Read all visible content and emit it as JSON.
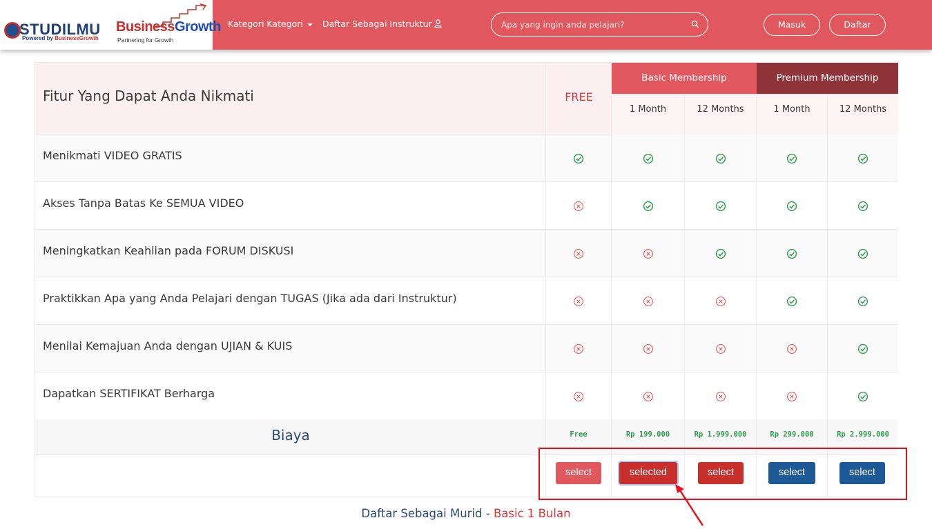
{
  "header": {
    "logo_studilmu": {
      "name": "STUDILMU",
      "tag_prefix": "Powered by",
      "tag_brand": "BusinessGrowth"
    },
    "logo_businessgrowth": {
      "name_part1": "Business",
      "name_part2": "Growth",
      "tagline": "Partnering for Growth"
    },
    "nav": {
      "kategori": "Kategori Kategori",
      "instruktur": "Daftar Sebagai Instruktur"
    },
    "search": {
      "placeholder": "Apa yang ingin anda pelajari?"
    },
    "buttons": {
      "masuk": "Masuk",
      "daftar": "Daftar"
    }
  },
  "table": {
    "title": "Fitur Yang Dapat Anda Nikmati",
    "free_label": "FREE",
    "groups": {
      "basic": "Basic Membership",
      "premium": "Premium Membership"
    },
    "subcolumns": [
      "1 Month",
      "12 Months",
      "1 Month",
      "12 Months"
    ],
    "features": [
      {
        "label": "Menikmati VIDEO GRATIS",
        "availability": [
          true,
          true,
          true,
          true,
          true
        ]
      },
      {
        "label": "Akses Tanpa Batas Ke SEMUA VIDEO",
        "availability": [
          false,
          true,
          true,
          true,
          true
        ]
      },
      {
        "label": "Meningkatkan Keahlian pada FORUM DISKUSI",
        "availability": [
          false,
          false,
          true,
          true,
          true
        ]
      },
      {
        "label": "Praktikkan Apa yang Anda Pelajari dengan TUGAS (Jika ada dari Instruktur)",
        "availability": [
          false,
          false,
          false,
          true,
          true
        ]
      },
      {
        "label": "Menilai Kemajuan Anda dengan UJIAN & KUIS",
        "availability": [
          false,
          false,
          false,
          false,
          true
        ]
      },
      {
        "label": "Dapatkan SERTIFIKAT Berharga",
        "availability": [
          false,
          false,
          false,
          false,
          true
        ]
      }
    ],
    "price_label": "Biaya",
    "prices": [
      "Free",
      "Rp 199.000",
      "Rp 1.999.000",
      "Rp 299.000",
      "Rp 2.999.000"
    ],
    "select_buttons": [
      "select",
      "selected",
      "select",
      "select",
      "select"
    ],
    "colors": {
      "check": "#2e9b4e",
      "cross": "#e0585e",
      "basic": "#e0585e",
      "premium": "#8f3438"
    }
  },
  "footer": {
    "prefix": "Daftar Sebagai Murid -",
    "plan": "Basic 1 Bulan"
  }
}
